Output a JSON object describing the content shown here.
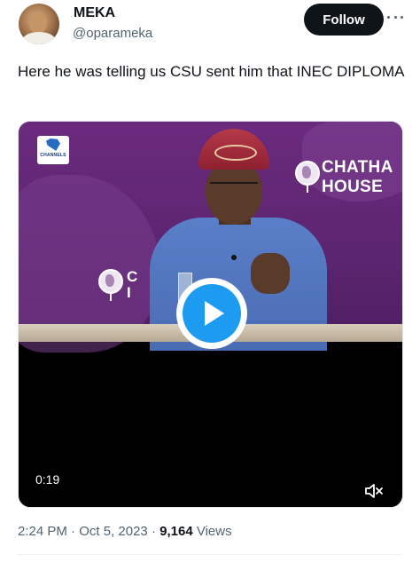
{
  "author": {
    "display_name": "MEKA",
    "handle": "@oparameka",
    "avatar_icon": "user-avatar"
  },
  "follow_label": "Follow",
  "more_icon": "more-horizontal-icon",
  "tweet": {
    "text": "Here he was telling us CSU sent him that INEC DIPLOMA"
  },
  "video": {
    "duration": "0:19",
    "play_icon": "play-icon",
    "volume_icon": "speaker-muted-icon",
    "overlay_logo_text": "CHANNELS",
    "backdrop_text": "CHATHA\nHOUSE",
    "backdrop_text_2": "C\nI"
  },
  "meta": {
    "time": "2:24 PM",
    "separator": " · ",
    "date": "Oct 5, 2023",
    "views_count": "9,164",
    "views_label": " Views"
  },
  "colors": {
    "accent": "#1d9bf0",
    "text_primary": "#0f1419",
    "text_secondary": "#536471",
    "stage_purple": "#5c2570"
  }
}
